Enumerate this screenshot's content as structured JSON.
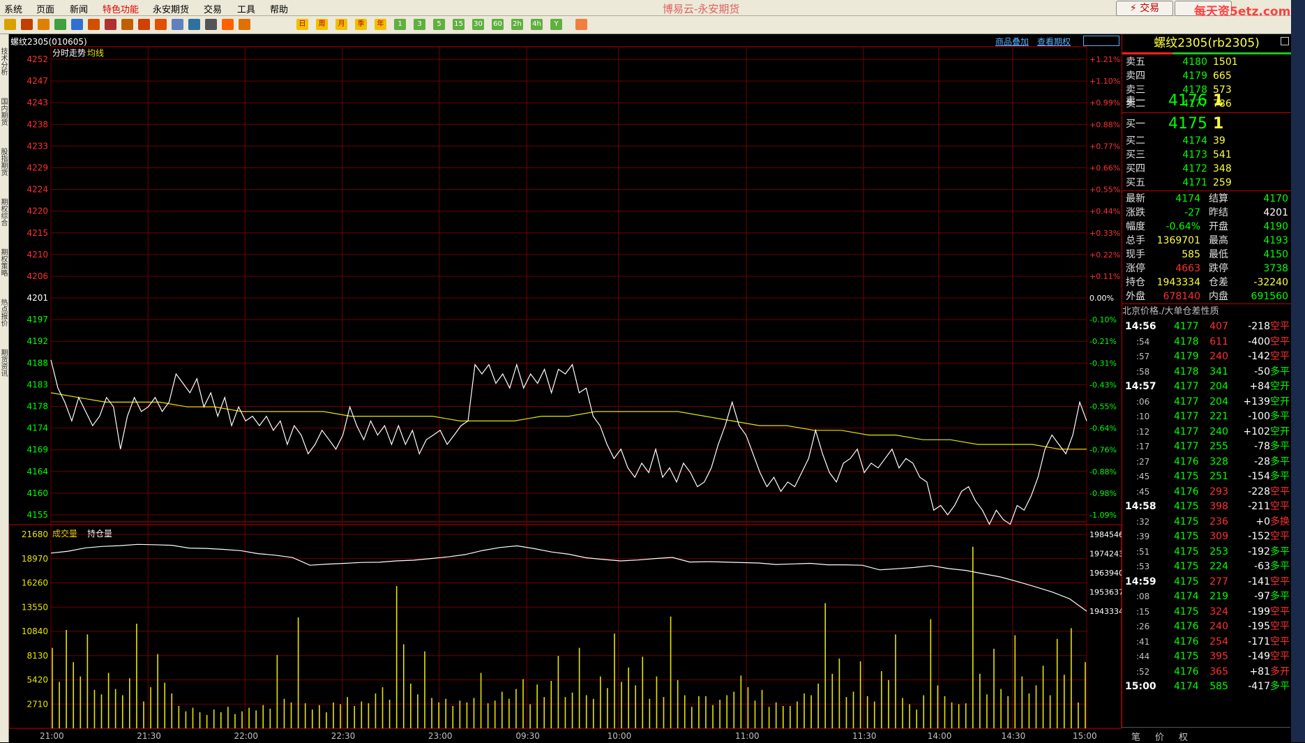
{
  "menu": [
    "系统",
    "页面",
    "新闻",
    "特色功能",
    "永安期货",
    "交易",
    "工具",
    "帮助"
  ],
  "app_title": "博易云-永安期货",
  "trade_button": "⚡ 交易",
  "watermark": "每天资5etz.com",
  "toolbar_icons": [
    "back-icon",
    "home-icon",
    "bookmark-icon",
    "news-icon",
    "refresh-icon",
    "zoom-in-icon",
    "zoom-out-icon",
    "window-icon",
    "pen-icon",
    "fire-icon",
    "funnel-icon",
    "flow-icon",
    "table-icon",
    "trend-icon",
    "tick-icon"
  ],
  "period_buttons": [
    "日",
    "周",
    "月",
    "季",
    "年",
    "1",
    "3",
    "5",
    "15",
    "30",
    "60",
    "2h",
    "4h",
    "Y"
  ],
  "leftbar_tabs": [
    "技术分析",
    "国内期货",
    "股指期货",
    "期权综合",
    "期权策略",
    "热点报价",
    "期货资讯"
  ],
  "chart_header": {
    "symbol": "螺纹2305(010605)",
    "link1": "商品叠加",
    "link2": "查看期权"
  },
  "price_panel": {
    "legend_a": "分时走势",
    "legend_b": "均线",
    "left_ticks": [
      "4252",
      "4247",
      "4243",
      "4238",
      "4233",
      "4229",
      "4224",
      "4220",
      "4215",
      "4210",
      "4206",
      "4201",
      "4197",
      "4192",
      "4188",
      "4183",
      "4178",
      "4174",
      "4169",
      "4164",
      "4160",
      "4155"
    ],
    "right_ticks": [
      "+1.21%",
      "+1.10%",
      "+0.99%",
      "+0.88%",
      "+0.77%",
      "+0.66%",
      "+0.55%",
      "+0.44%",
      "+0.33%",
      "+0.22%",
      "+0.11%",
      "0.00%",
      "-0.10%",
      "-0.21%",
      "-0.31%",
      "-0.43%",
      "-0.55%",
      "-0.64%",
      "-0.76%",
      "-0.88%",
      "-0.98%",
      "-1.09%"
    ]
  },
  "volume_panel": {
    "legend_a": "成交量",
    "legend_b": "持仓量",
    "left_ticks": [
      "21680",
      "18970",
      "16260",
      "13550",
      "10840",
      "8130",
      "5420",
      "2710"
    ],
    "right_ticks": [
      "1984546",
      "1974243",
      "1963940",
      "1953637",
      "1943334"
    ]
  },
  "time_axis": [
    "21:00",
    "21:30",
    "22:00",
    "22:30",
    "23:00",
    "09:30",
    "10:00",
    "11:00",
    "11:30",
    "14:00",
    "14:30",
    "15:00"
  ],
  "colors": {
    "up": "#ff3030",
    "down": "#00ff00",
    "grid": "#800000",
    "price": "#ffffff",
    "avg": "#e6e600",
    "volume": "#e6e600"
  },
  "quote": {
    "title": "螺纹2305(rb2305)",
    "asks": [
      {
        "label": "卖五",
        "price": "4180",
        "vol": "1501"
      },
      {
        "label": "卖四",
        "price": "4179",
        "vol": "665"
      },
      {
        "label": "卖三",
        "price": "4178",
        "vol": "573"
      },
      {
        "label": "卖二",
        "price": "4177",
        "vol": "786"
      },
      {
        "label": "卖一",
        "price": "4176",
        "vol": "1"
      }
    ],
    "bids": [
      {
        "label": "买一",
        "price": "4175",
        "vol": "1"
      },
      {
        "label": "买二",
        "price": "4174",
        "vol": "39"
      },
      {
        "label": "买三",
        "price": "4173",
        "vol": "541"
      },
      {
        "label": "买四",
        "price": "4172",
        "vol": "348"
      },
      {
        "label": "买五",
        "price": "4171",
        "vol": "259"
      }
    ],
    "stats": [
      {
        "l1": "最新",
        "v1": "4174",
        "c1": "green",
        "l2": "结算",
        "v2": "4170",
        "c2": "green"
      },
      {
        "l1": "涨跌",
        "v1": "-27",
        "c1": "green",
        "l2": "昨结",
        "v2": "4201",
        "c2": "white"
      },
      {
        "l1": "幅度",
        "v1": "-0.64%",
        "c1": "green",
        "l2": "开盘",
        "v2": "4190",
        "c2": "green"
      },
      {
        "l1": "总手",
        "v1": "1369701",
        "c1": "yellow",
        "l2": "最高",
        "v2": "4193",
        "c2": "green"
      },
      {
        "l1": "现手",
        "v1": "585",
        "c1": "yellow",
        "l2": "最低",
        "v2": "4150",
        "c2": "green"
      },
      {
        "l1": "涨停",
        "v1": "4663",
        "c1": "red",
        "l2": "跌停",
        "v2": "3738",
        "c2": "green"
      },
      {
        "l1": "持仓",
        "v1": "1943334",
        "c1": "yellow",
        "l2": "仓差",
        "v2": "-32240",
        "c2": "yellow"
      },
      {
        "l1": "外盘",
        "v1": "678140",
        "c1": "red",
        "l2": "内盘",
        "v2": "691560",
        "c2": "green"
      }
    ],
    "tick_header": {
      "time": "北京",
      "price": "价格",
      "vol": "./大单",
      "oi": "仓差",
      "nature": "性质"
    },
    "ticks": [
      {
        "t": "14:56",
        "p": "4177",
        "v": "407",
        "oi": "-218",
        "n": "空平",
        "tc": "white",
        "vc": "red",
        "nc": "red"
      },
      {
        "t": ":54",
        "p": "4178",
        "v": "611",
        "oi": "-400",
        "n": "空平",
        "tc": "gray",
        "vc": "red",
        "nc": "red"
      },
      {
        "t": ":57",
        "p": "4179",
        "v": "240",
        "oi": "-142",
        "n": "空平",
        "tc": "gray",
        "vc": "red",
        "nc": "red"
      },
      {
        "t": ":58",
        "p": "4178",
        "v": "341",
        "oi": "-50",
        "n": "多平",
        "tc": "gray",
        "vc": "green",
        "nc": "green"
      },
      {
        "t": "14:57",
        "p": "4177",
        "v": "204",
        "oi": "+84",
        "n": "空开",
        "tc": "white",
        "vc": "green",
        "nc": "green"
      },
      {
        "t": ":06",
        "p": "4177",
        "v": "204",
        "oi": "+139",
        "n": "空开",
        "tc": "gray",
        "vc": "green",
        "nc": "green"
      },
      {
        "t": ":10",
        "p": "4177",
        "v": "221",
        "oi": "-100",
        "n": "多平",
        "tc": "gray",
        "vc": "green",
        "nc": "green"
      },
      {
        "t": ":12",
        "p": "4177",
        "v": "240",
        "oi": "+102",
        "n": "空开",
        "tc": "gray",
        "vc": "green",
        "nc": "green"
      },
      {
        "t": ":17",
        "p": "4177",
        "v": "255",
        "oi": "-78",
        "n": "多平",
        "tc": "gray",
        "vc": "green",
        "nc": "green"
      },
      {
        "t": ":27",
        "p": "4176",
        "v": "328",
        "oi": "-28",
        "n": "多平",
        "tc": "gray",
        "vc": "green",
        "nc": "green"
      },
      {
        "t": ":45",
        "p": "4175",
        "v": "251",
        "oi": "-154",
        "n": "多平",
        "tc": "gray",
        "vc": "green",
        "nc": "green"
      },
      {
        "t": ":45",
        "p": "4176",
        "v": "293",
        "oi": "-228",
        "n": "空平",
        "tc": "gray",
        "vc": "red",
        "nc": "red"
      },
      {
        "t": "14:58",
        "p": "4175",
        "v": "398",
        "oi": "-211",
        "n": "空平",
        "tc": "white",
        "vc": "red",
        "nc": "red"
      },
      {
        "t": ":32",
        "p": "4175",
        "v": "236",
        "oi": "+0",
        "n": "多换",
        "tc": "gray",
        "vc": "red",
        "nc": "red"
      },
      {
        "t": ":39",
        "p": "4175",
        "v": "309",
        "oi": "-152",
        "n": "空平",
        "tc": "gray",
        "vc": "red",
        "nc": "red"
      },
      {
        "t": ":51",
        "p": "4175",
        "v": "253",
        "oi": "-192",
        "n": "多平",
        "tc": "gray",
        "vc": "green",
        "nc": "green"
      },
      {
        "t": ":53",
        "p": "4175",
        "v": "224",
        "oi": "-63",
        "n": "多平",
        "tc": "gray",
        "vc": "green",
        "nc": "green"
      },
      {
        "t": "14:59",
        "p": "4175",
        "v": "277",
        "oi": "-141",
        "n": "空平",
        "tc": "white",
        "vc": "red",
        "nc": "red"
      },
      {
        "t": ":08",
        "p": "4174",
        "v": "219",
        "oi": "-97",
        "n": "多平",
        "tc": "gray",
        "vc": "green",
        "nc": "green"
      },
      {
        "t": ":15",
        "p": "4175",
        "v": "324",
        "oi": "-199",
        "n": "空平",
        "tc": "gray",
        "vc": "red",
        "nc": "red"
      },
      {
        "t": ":26",
        "p": "4176",
        "v": "240",
        "oi": "-195",
        "n": "空平",
        "tc": "gray",
        "vc": "red",
        "nc": "red"
      },
      {
        "t": ":41",
        "p": "4176",
        "v": "254",
        "oi": "-171",
        "n": "空平",
        "tc": "gray",
        "vc": "red",
        "nc": "red"
      },
      {
        "t": ":44",
        "p": "4175",
        "v": "395",
        "oi": "-149",
        "n": "空平",
        "tc": "gray",
        "vc": "red",
        "nc": "red"
      },
      {
        "t": ":52",
        "p": "4176",
        "v": "365",
        "oi": "+81",
        "n": "多开",
        "tc": "gray",
        "vc": "red",
        "nc": "red"
      },
      {
        "t": "15:00",
        "p": "4174",
        "v": "585",
        "oi": "-417",
        "n": "多平",
        "tc": "white",
        "vc": "green",
        "nc": "green"
      }
    ],
    "bottom_tabs": [
      "笔",
      "价",
      "权"
    ]
  },
  "chart_data": [
    {
      "type": "line",
      "title": "",
      "series": [
        {
          "name": "分时走势",
          "values": [
            4188,
            4182,
            4179,
            4175,
            4180,
            4177,
            4174,
            4176,
            4180,
            4178,
            4169,
            4176,
            4180,
            4177,
            4178,
            4180,
            4177,
            4179,
            4185,
            4183,
            4181,
            4184,
            4178,
            4181,
            4176,
            4180,
            4174,
            4178,
            4175,
            4176,
            4174,
            4176,
            4173,
            4175,
            4170,
            4174,
            4172,
            4168,
            4170,
            4173,
            4171,
            4169,
            4172,
            4178,
            4174,
            4171,
            4175,
            4172,
            4174,
            4170,
            4174,
            4170,
            4173,
            4168,
            4171,
            4172,
            4173,
            4170,
            4172,
            4174,
            4175,
            4187,
            4185,
            4187,
            4183,
            4185,
            4182,
            4187,
            4182,
            4185,
            4183,
            4186,
            4181,
            4186,
            4185,
            4187,
            4181,
            4182,
            4176,
            4174,
            4170,
            4167,
            4169,
            4165,
            4163,
            4166,
            4164,
            4169,
            4163,
            4165,
            4162,
            4166,
            4164,
            4161,
            4162,
            4165,
            4170,
            4174,
            4179,
            4174,
            4172,
            4168,
            4164,
            4161,
            4163,
            4160,
            4162,
            4161,
            4164,
            4167,
            4173,
            4168,
            4164,
            4162,
            4166,
            4167,
            4169,
            4164,
            4166,
            4165,
            4167,
            4169,
            4165,
            4167,
            4166,
            4163,
            4162,
            4156,
            4157,
            4155,
            4157,
            4160,
            4161,
            4158,
            4156,
            4153,
            4156,
            4154,
            4153,
            4157,
            4156,
            4159,
            4163,
            4169,
            4172,
            4170,
            4168,
            4172,
            4179,
            4175
          ],
          "x_start": "21:00",
          "x_end": "15:00"
        },
        {
          "name": "均线",
          "values": [
            4181,
            4180,
            4179,
            4179,
            4179,
            4178,
            4178,
            4177,
            4177,
            4177,
            4177,
            4176,
            4176,
            4176,
            4176,
            4175,
            4175,
            4175,
            4176,
            4176,
            4177,
            4177,
            4177,
            4177,
            4176,
            4175,
            4174,
            4174,
            4173,
            4173,
            4172,
            4172,
            4171,
            4171,
            4170,
            4170,
            4170,
            4169,
            4169
          ],
          "x_start": "21:00",
          "x_end": "15:00"
        }
      ],
      "ylim": [
        4153,
        4252
      ],
      "ylabel": "",
      "xlabel": ""
    },
    {
      "type": "bar",
      "title": "",
      "series": [
        {
          "name": "成交量",
          "values": [
            9000,
            5200,
            11000,
            7400,
            5800,
            10500,
            4300,
            3800,
            6200,
            4400,
            3700,
            5600,
            11700,
            3000,
            4600,
            8300,
            5100,
            3900,
            2500,
            1900,
            2300,
            1800,
            1500,
            2100,
            1800,
            2400,
            1600,
            1900,
            2300,
            2000,
            2600,
            2200,
            8200,
            3300,
            2900,
            12400,
            2800,
            2100,
            2600,
            1800,
            2900,
            2700,
            3500,
            2500,
            3000,
            2800,
            3900,
            4600,
            3200,
            15900,
            9400,
            5000,
            3800,
            8600,
            3400,
            2900,
            3300,
            2500,
            3100,
            2900,
            3400,
            6200,
            2800,
            3100,
            4100,
            3300,
            4400,
            5500,
            2700,
            4900,
            3500,
            5300,
            8100,
            3500,
            4000,
            9000,
            3700,
            3300,
            5800,
            4500,
            10600,
            5200,
            6800,
            4800,
            8000,
            3300,
            5800,
            3500,
            12500,
            5400,
            3700,
            2400,
            3600,
            3600,
            2600,
            3200,
            3700,
            4100,
            5900,
            4600,
            3100,
            4300,
            2400,
            2900,
            2500,
            2500,
            3000,
            3900,
            3700,
            5000,
            14000,
            6100,
            7800,
            3500,
            4100,
            7500,
            3600,
            3000,
            6400,
            5400,
            10500,
            3400,
            2700,
            2100,
            3700,
            12200,
            4800,
            3600,
            2900,
            2700,
            2800,
            20300,
            6100,
            3800,
            8900,
            4400,
            3600,
            10400,
            5800,
            3900,
            4800,
            7000,
            3700,
            10000,
            6000,
            11200,
            2900,
            7400
          ],
          "x_start": "21:00",
          "x_end": "15:00"
        },
        {
          "name": "持仓量",
          "values": [
            1974500,
            1975500,
            1977300,
            1978100,
            1978500,
            1979200,
            1979000,
            1978700,
            1977200,
            1977000,
            1976500,
            1975800,
            1974200,
            1973400,
            1972100,
            1968000,
            1968600,
            1969000,
            1969500,
            1969600,
            1970300,
            1970700,
            1971600,
            1972500,
            1973700,
            1975900,
            1977500,
            1978400,
            1976900,
            1975100,
            1973900,
            1972000,
            1971100,
            1970300,
            1970800,
            1971600,
            1972200,
            1969700,
            1969900,
            1969700,
            1969400,
            1969200,
            1968400,
            1968700,
            1969000,
            1968200,
            1968200,
            1968000,
            1965500,
            1966100,
            1966800,
            1967800,
            1966200,
            1965200,
            1963400,
            1961700,
            1959200,
            1956500,
            1953600,
            1950000,
            1943300
          ],
          "x_start": "21:00",
          "x_end": "15:00"
        }
      ],
      "ylim": [
        0,
        21680
      ],
      "ylim_right": [
        1943334,
        1984546
      ]
    }
  ]
}
